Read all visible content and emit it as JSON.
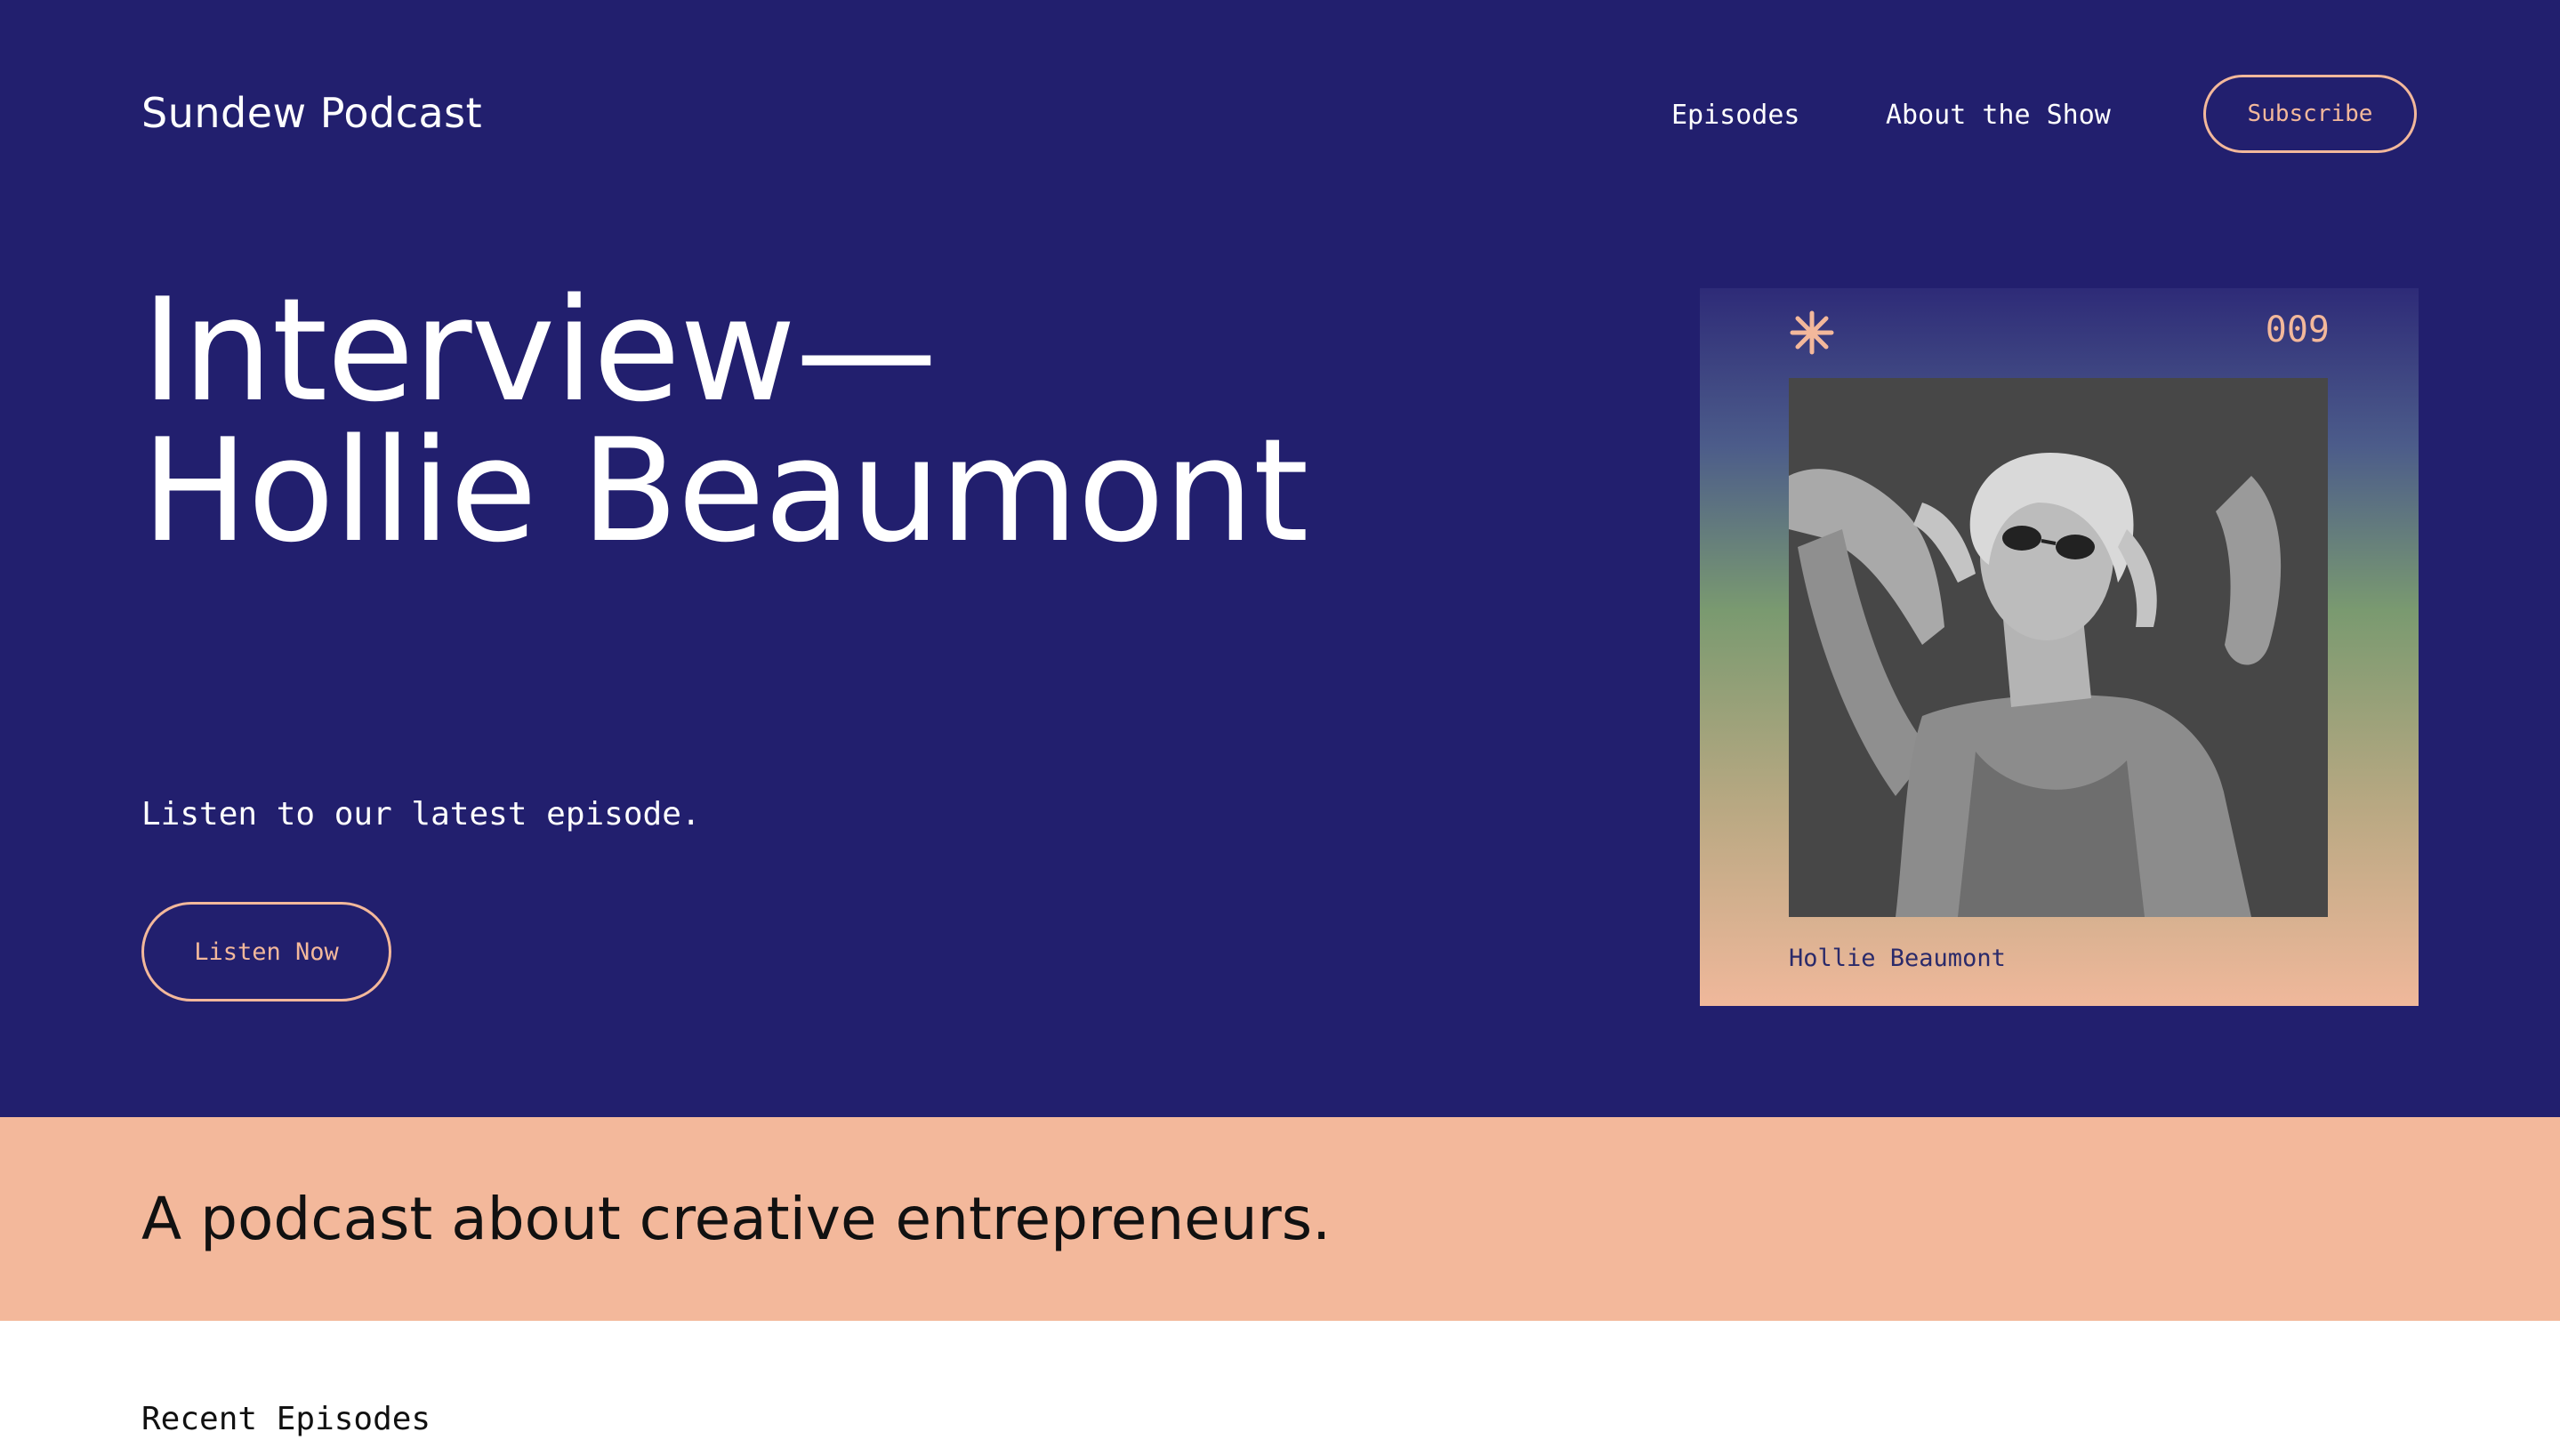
{
  "header": {
    "site_title": "Sundew Podcast",
    "nav": [
      {
        "label": "Episodes"
      },
      {
        "label": "About the Show"
      }
    ],
    "subscribe_label": "Subscribe"
  },
  "hero": {
    "title_line1": "Interview—",
    "title_line2": "Hollie Beaumont",
    "tagline": "Listen to our latest episode.",
    "cta_label": "Listen Now"
  },
  "episode_card": {
    "icon": "asterisk-icon",
    "number": "009",
    "guest_name": "Hollie Beaumont",
    "photo": "black-and-white portrait of woman in sunglasses"
  },
  "banner": {
    "text": "A podcast about creative entrepreneurs."
  },
  "recent": {
    "heading": "Recent Episodes"
  },
  "colors": {
    "hero_bg": "#221f6e",
    "accent": "#f3b89b",
    "banner_bg": "#f3b89b",
    "text_dark": "#111111"
  }
}
